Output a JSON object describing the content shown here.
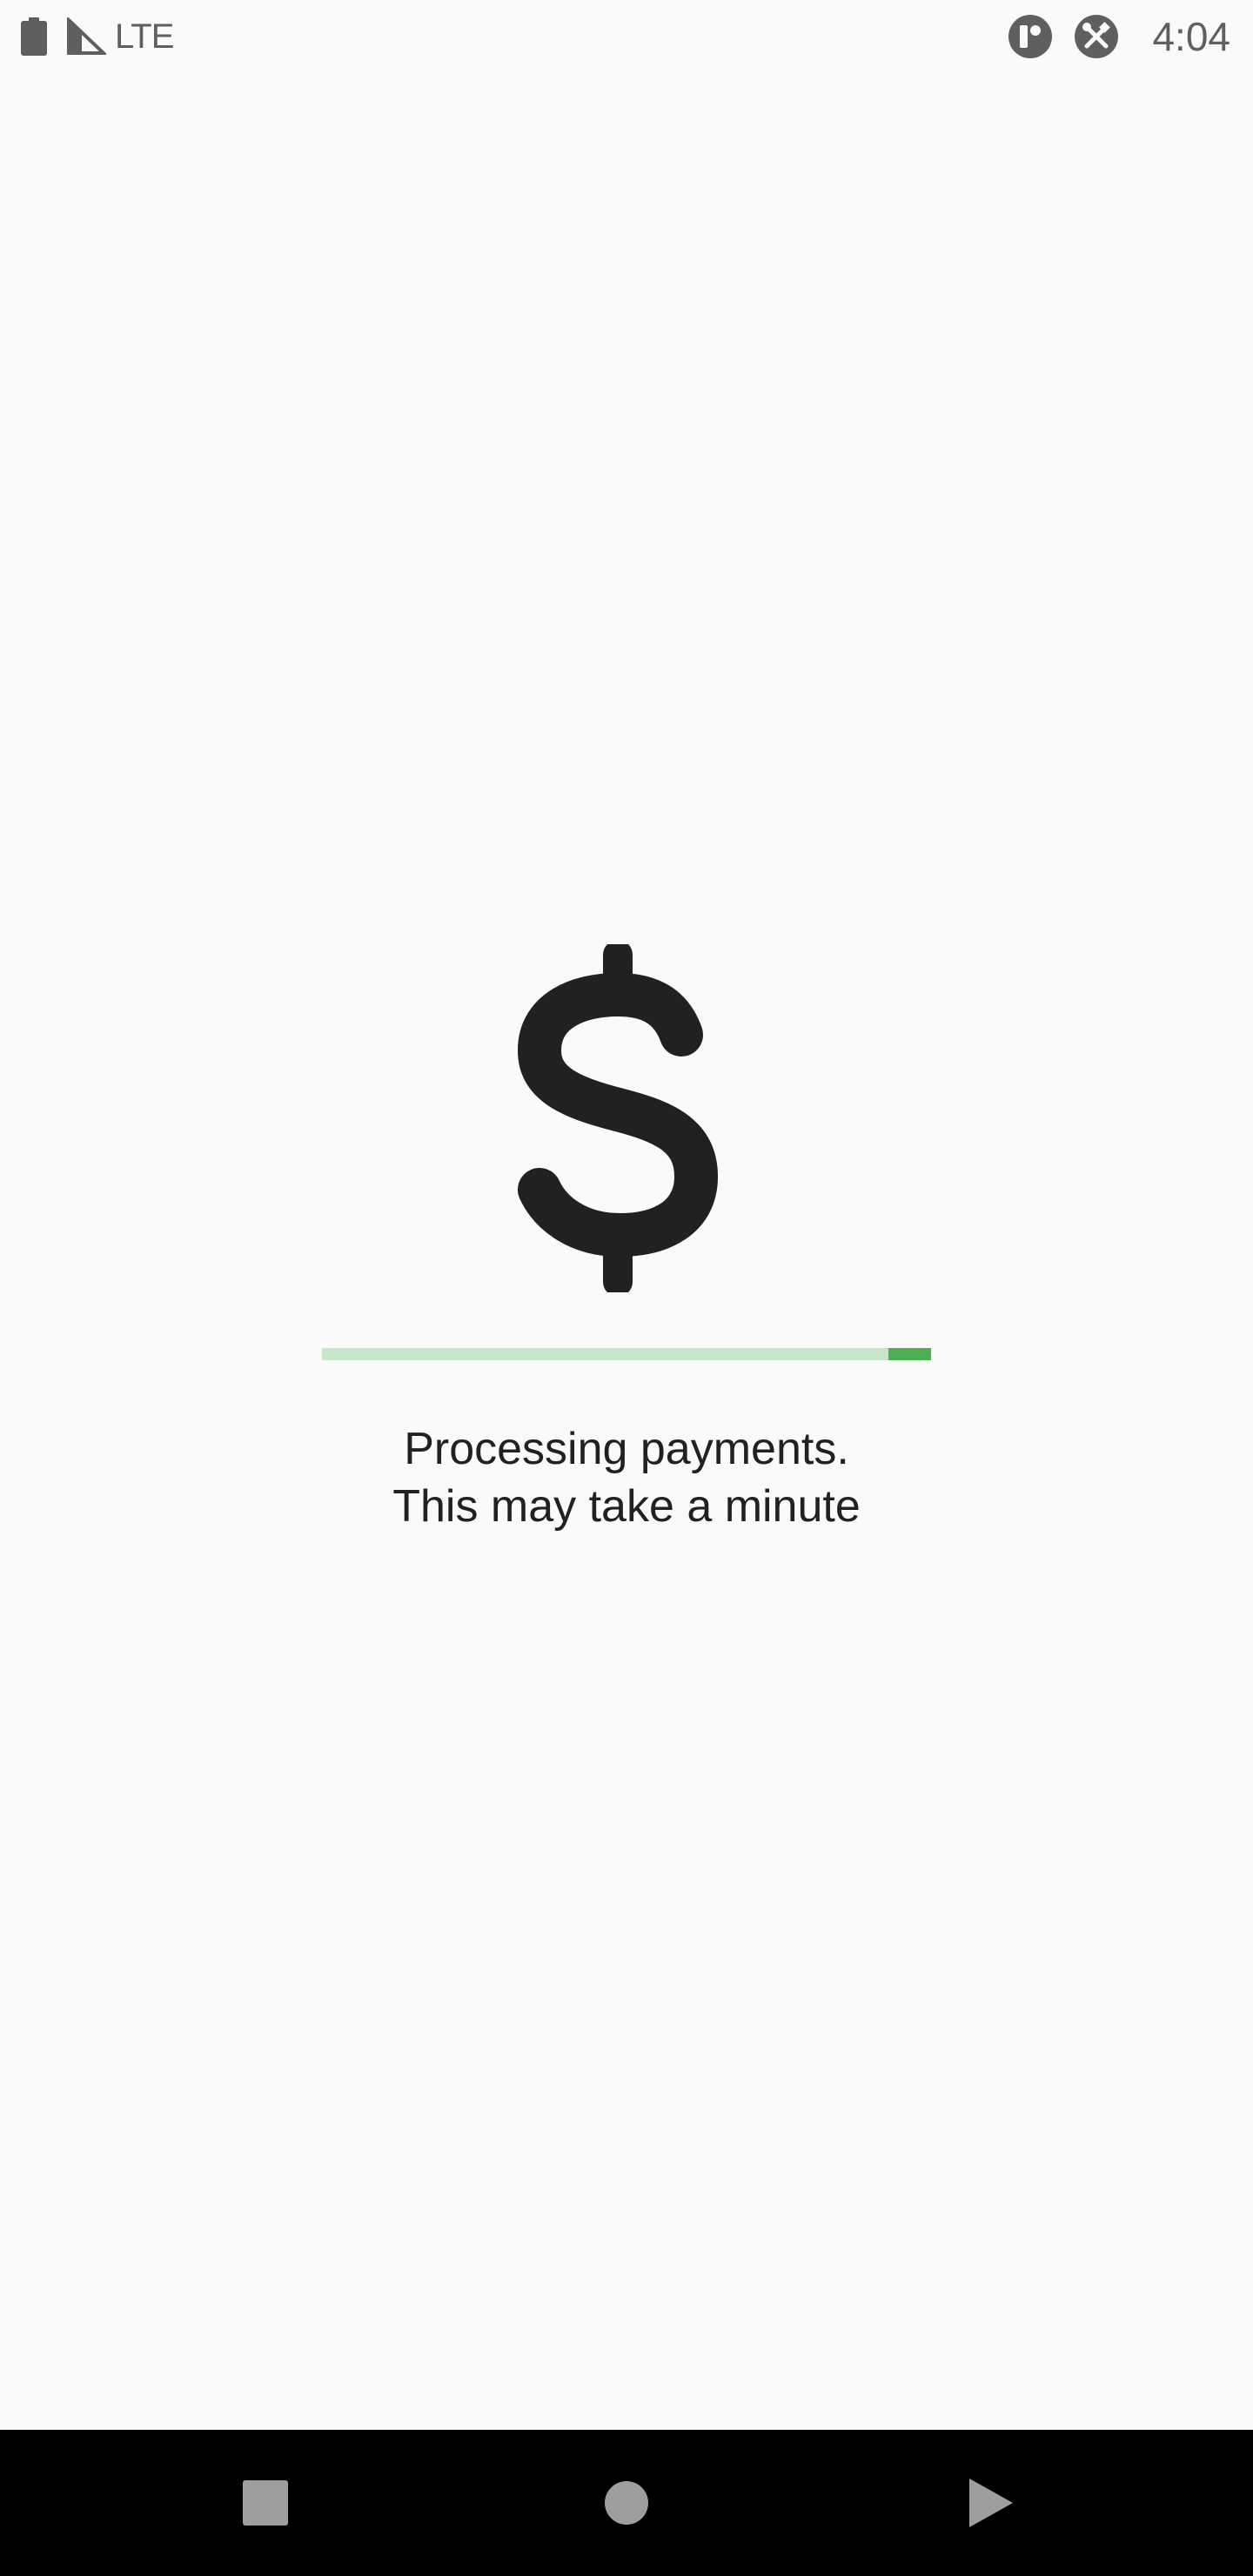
{
  "status_bar": {
    "network": "LTE",
    "time": "4:04",
    "icons": [
      "battery-icon",
      "signal-icon",
      "app-notification-icon",
      "tools-icon"
    ]
  },
  "main": {
    "icon": "dollar-sign-icon",
    "progress": {
      "indeterminate": true,
      "indicator_position_fraction": 0.93,
      "indicator_length_fraction": 0.07,
      "track_color": "#c8e6c9",
      "indicator_color": "#4caf50"
    },
    "message_line1": "Processing payments.",
    "message_line2": "This may take a minute"
  },
  "nav_bar": {
    "buttons": [
      "recents-button",
      "home-button",
      "back-button"
    ]
  }
}
